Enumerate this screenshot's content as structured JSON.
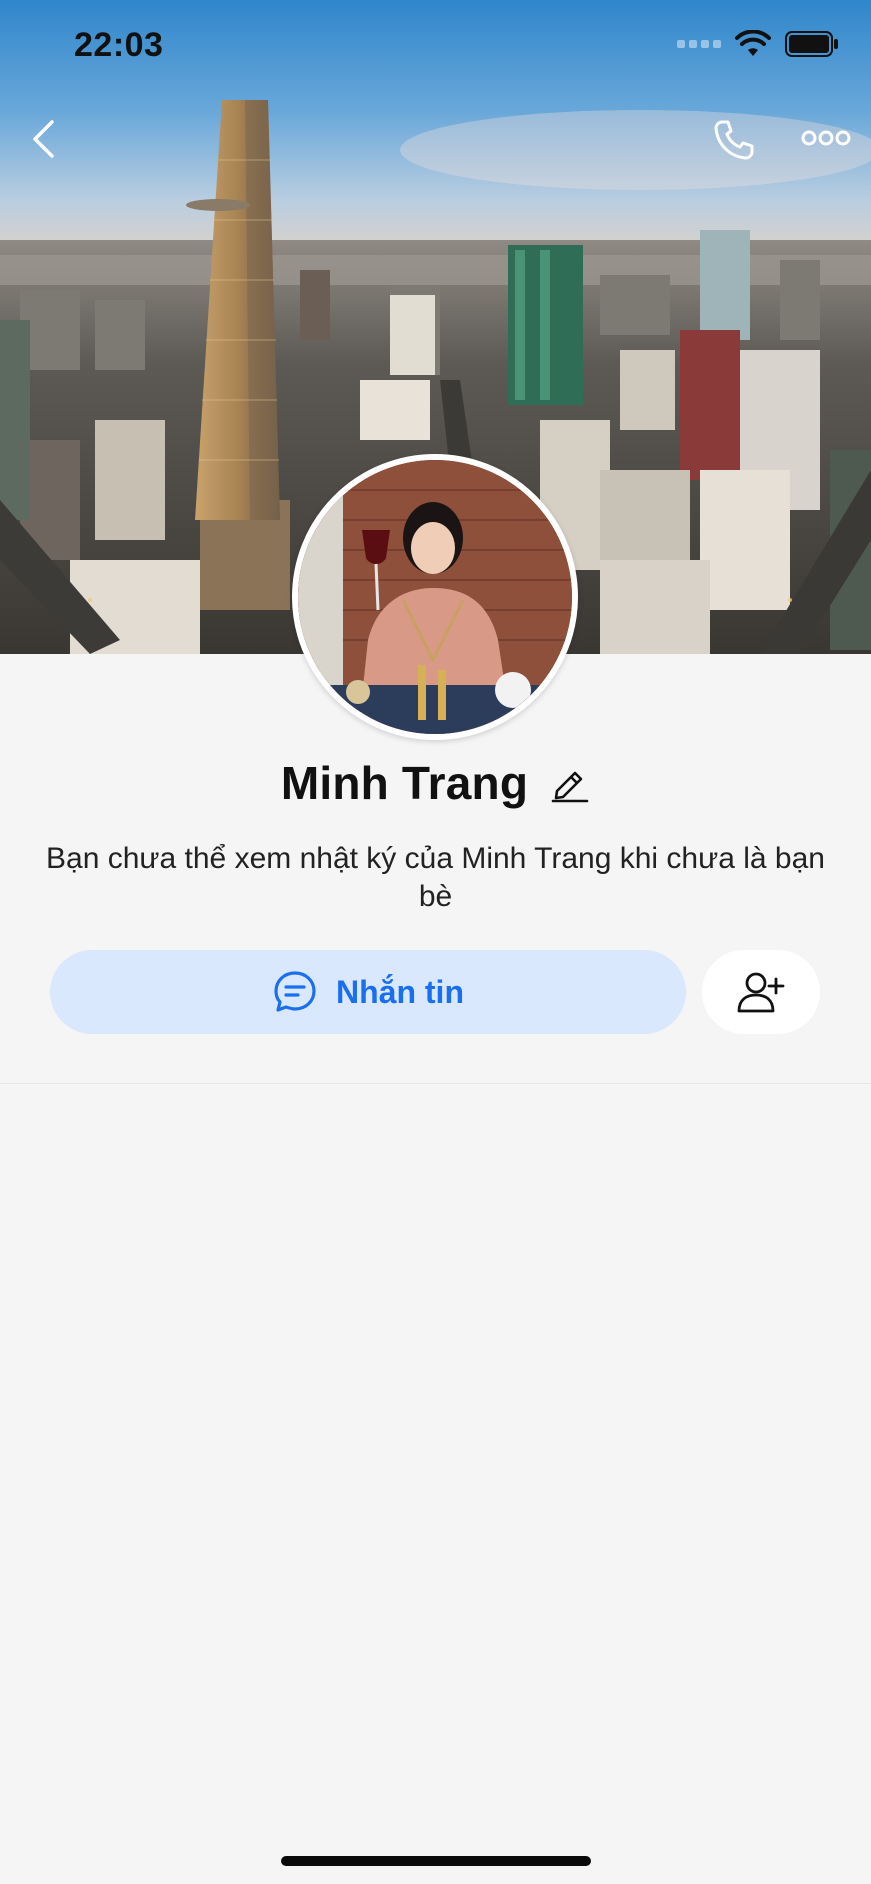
{
  "status_bar": {
    "time": "22:03",
    "icons": [
      "cellular-signal-icon",
      "wifi-icon",
      "battery-icon"
    ]
  },
  "nav": {
    "back_icon": "chevron-left-icon",
    "call_icon": "phone-icon",
    "more_icon": "ellipsis-icon"
  },
  "profile": {
    "name": "Minh Trang",
    "edit_icon": "pencil-icon",
    "description": "Bạn chưa thể xem nhật ký của Minh Trang khi chưa là bạn bè"
  },
  "actions": {
    "message_label": "Nhắn tin",
    "message_icon": "chat-bubble-icon",
    "add_friend_icon": "add-user-icon"
  },
  "colors": {
    "accent": "#1a6ef0",
    "message_button_bg": "#d9e8fc",
    "page_bg": "#f5f5f6"
  }
}
